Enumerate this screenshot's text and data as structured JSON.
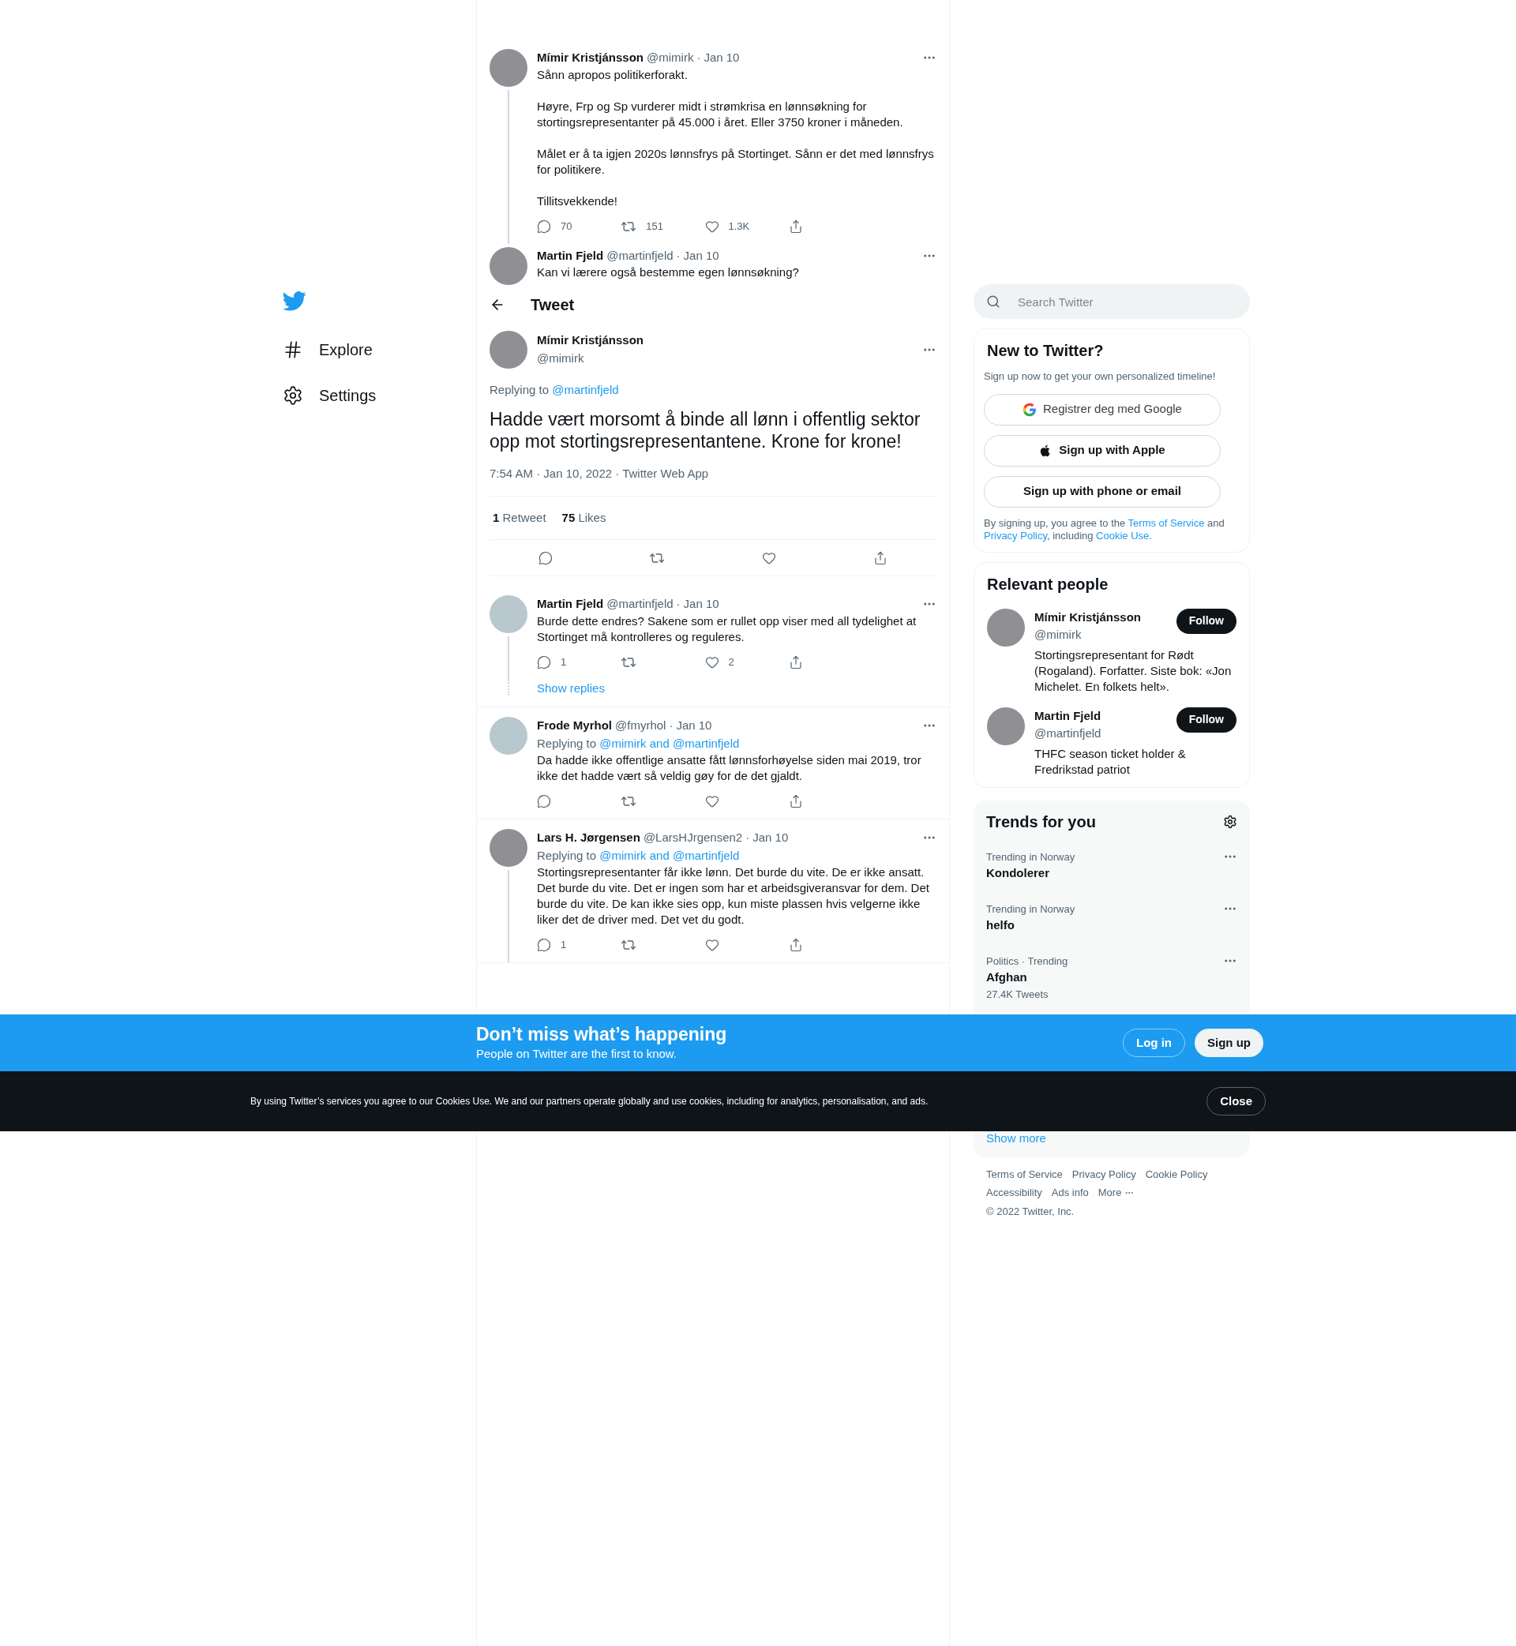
{
  "nav": {
    "items": [
      {
        "label": "Explore"
      },
      {
        "label": "Settings"
      }
    ]
  },
  "thread": [
    {
      "name": "Mímir Kristjánsson",
      "handle": "@mimirk",
      "separator": "·",
      "date": "Jan 10",
      "has_photo": true,
      "text": "Sånn apropos politikerforakt.\n\nHøyre, Frp og Sp vurderer midt i strømkrisa en lønnsøkning for stortingsrepresentanter på 45.000 i året. Eller 3750 kroner i måneden.\n\nMålet er å ta igjen 2020s lønnsfrys på Stortinget. Sånn er det med lønnsfrys for politikere.\n\nTillitsvekkende!",
      "actions": [
        {
          "kind": "reply",
          "count": "70"
        },
        {
          "kind": "retweet",
          "count": "151"
        },
        {
          "kind": "like",
          "count": "1.3K"
        },
        {
          "kind": "share"
        }
      ]
    },
    {
      "name": "Martin Fjeld",
      "handle": "@martinfjeld",
      "separator": "·",
      "date": "Jan 10",
      "has_photo": true,
      "text": "Kan vi lærere også bestemme egen lønnsøkning?"
    }
  ],
  "header": {
    "title": "Tweet"
  },
  "focus_tweet": {
    "name": "Mímir Kristjánsson",
    "handle": "@mimirk",
    "has_photo": true,
    "replying_to": {
      "label": "Replying to",
      "mention": "@martinfjeld"
    },
    "text": "Hadde vært morsomt å binde all lønn i offentlig sektor opp mot stortingsrepresentantene. Krone for krone!",
    "meta": "7:54 AM · Jan 10, 2022 · Twitter Web App",
    "stats": [
      {
        "count": "1",
        "label": "Retweet"
      },
      {
        "count": "75",
        "label": "Likes"
      }
    ]
  },
  "replies": [
    {
      "name": "Martin Fjeld",
      "handle": "@martinfjeld",
      "separator": "·",
      "date": "Jan 10",
      "has_photo": false,
      "text": "Burde dette endres? Sakene som er rullet opp viser med all tydelighet at Stortinget må kontrolleres og reguleres.",
      "actions": [
        {
          "kind": "reply",
          "count": "1"
        },
        {
          "kind": "retweet"
        },
        {
          "kind": "like",
          "count": "2"
        },
        {
          "kind": "share"
        }
      ],
      "show_replies": "Show replies"
    },
    {
      "name": "Frode Myrhol",
      "handle": "@fmyrhol",
      "separator": "·",
      "date": "Jan 10",
      "has_photo": false,
      "replying_to": {
        "label": "Replying to",
        "mention": "@mimirk and @martinfjeld"
      },
      "text": "Da hadde ikke offentlige ansatte fått lønnsforhøyelse siden mai 2019, tror ikke det hadde vært så veldig gøy for de det gjaldt.",
      "actions": [
        {
          "kind": "reply"
        },
        {
          "kind": "retweet"
        },
        {
          "kind": "like"
        },
        {
          "kind": "share"
        }
      ]
    },
    {
      "name": "Lars H. Jørgensen",
      "handle": "@LarsHJrgensen2",
      "separator": "·",
      "date": "Jan 10",
      "has_photo": true,
      "replying_to": {
        "label": "Replying to",
        "mention": "@mimirk and @martinfjeld"
      },
      "text": "Stortingsrepresentanter får ikke lønn. Det burde du vite. De er ikke ansatt. Det burde du vite. Det er ingen som har et arbeidsgiveransvar for dem. Det burde du vite. De kan ikke sies opp, kun miste plassen hvis velgerne ikke liker det de driver med. Det vet du godt.",
      "actions": [
        {
          "kind": "reply",
          "count": "1"
        },
        {
          "kind": "retweet"
        },
        {
          "kind": "like"
        },
        {
          "kind": "share"
        }
      ]
    }
  ],
  "search": {
    "placeholder": "Search Twitter"
  },
  "signup_card": {
    "title": "New to Twitter?",
    "subtitle": "Sign up now to get your own personalized timeline!",
    "buttons": [
      {
        "kind": "google",
        "label": "Registrer deg med Google"
      },
      {
        "kind": "apple",
        "label": "Sign up with Apple"
      },
      {
        "kind": "plain",
        "label": "Sign up with phone or email"
      }
    ],
    "legal": [
      {
        "text": "By signing up, you agree to the "
      },
      {
        "text": "Terms of Service",
        "link": true
      },
      {
        "text": " and "
      },
      {
        "text": "Privacy Policy",
        "link": true
      },
      {
        "text": ", including "
      },
      {
        "text": "Cookie Use.",
        "link": true
      }
    ]
  },
  "relevant_people": {
    "title": "Relevant people",
    "people": [
      {
        "name": "Mímir Kristjánsson",
        "handle": "@mimirk",
        "bio": "Stortingsrepresentant for Rødt (Rogaland). Forfatter. Siste bok: «Jon Michelet. En folkets helt».",
        "button": "Follow"
      },
      {
        "name": "Martin Fjeld",
        "handle": "@martinfjeld",
        "bio": "THFC season ticket holder & Fredrikstad patriot",
        "button": "Follow"
      }
    ]
  },
  "trends": {
    "title": "Trends for you",
    "items": [
      {
        "context": "Trending in Norway",
        "name": "Kondolerer"
      },
      {
        "context": "Trending in Norway",
        "name": "helfo"
      },
      {
        "context": "Politics · Trending",
        "name": "Afghan",
        "count": "27.4K Tweets"
      }
    ],
    "show_more": "Show more"
  },
  "footer": {
    "links": [
      "Terms of Service",
      "Privacy Policy",
      "Cookie Policy",
      "Accessibility",
      "Ads info"
    ],
    "more": "More",
    "copyright": "© 2022 Twitter, Inc."
  },
  "signup_banner": {
    "title": "Don’t miss what’s happening",
    "subtitle": "People on Twitter are the first to know.",
    "login": "Log in",
    "signup": "Sign up"
  },
  "cookie_banner": {
    "text": "By using Twitter’s services you agree to our Cookies Use. We and our partners operate globally and use cookies, including for analytics, personalisation, and ads.",
    "close": "Close"
  }
}
